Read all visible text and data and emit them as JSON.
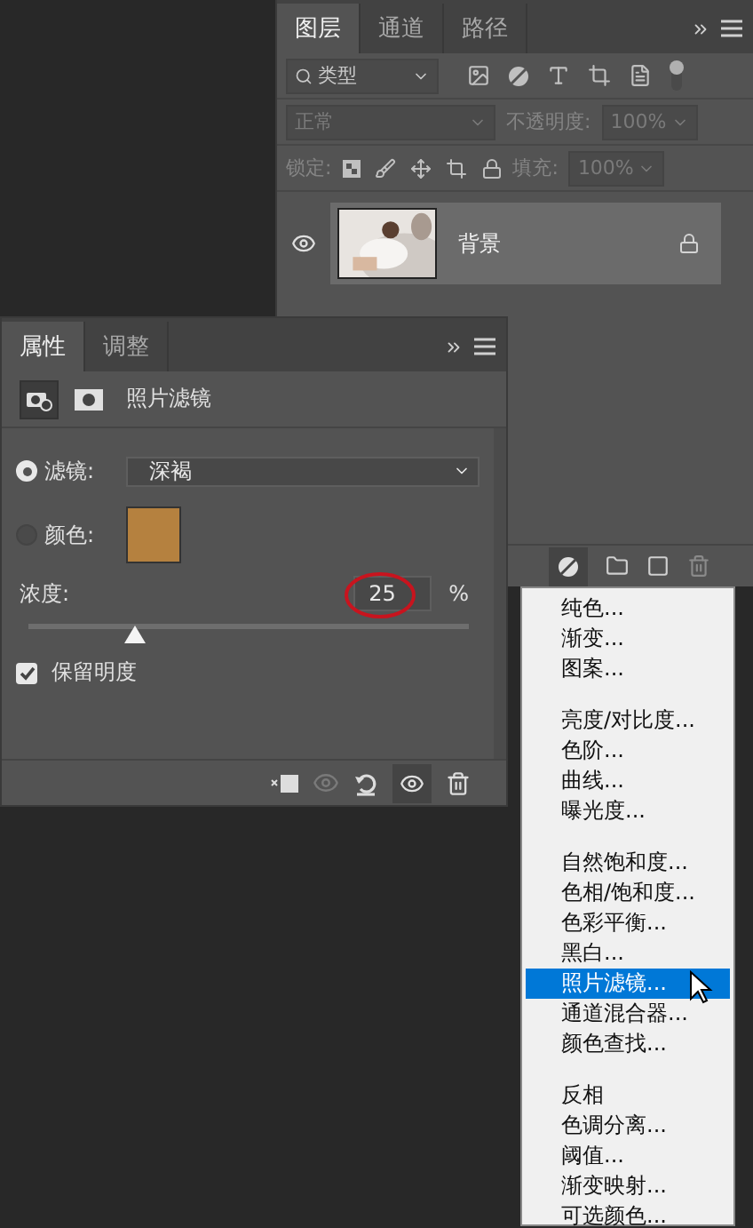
{
  "layers_panel": {
    "tabs": [
      {
        "label": "图层",
        "selected": true
      },
      {
        "label": "通道",
        "selected": false
      },
      {
        "label": "路径",
        "selected": false
      }
    ],
    "filter": {
      "label": "类型"
    },
    "blend_mode": "正常",
    "opacity_label": "不透明度:",
    "opacity": "100%",
    "lock_label": "锁定:",
    "fill_label": "填充:",
    "fill": "100%",
    "layers": [
      {
        "name": "背景",
        "visible": true,
        "locked": true,
        "selected": true
      }
    ]
  },
  "properties_panel": {
    "tabs": [
      {
        "label": "属性",
        "selected": true
      },
      {
        "label": "调整",
        "selected": false
      }
    ],
    "title": "照片滤镜",
    "options": [
      {
        "kind": "filter",
        "label": "滤镜:",
        "selected": true,
        "value": "深褐"
      },
      {
        "kind": "color",
        "label": "颜色:",
        "selected": false,
        "color": "#b5813f"
      }
    ],
    "density_label": "浓度:",
    "density": "25",
    "unit": "%",
    "density_slider": {
      "level": 0.24
    },
    "preserve": {
      "label": "保留明度",
      "checked": true
    }
  },
  "adjustment_menu": {
    "groups": [
      [
        {
          "label": "纯色...",
          "selected": false
        },
        {
          "label": "渐变...",
          "selected": false
        },
        {
          "label": "图案...",
          "selected": false
        }
      ],
      [
        {
          "label": "亮度/对比度...",
          "selected": false
        },
        {
          "label": "色阶...",
          "selected": false
        },
        {
          "label": "曲线...",
          "selected": false
        },
        {
          "label": "曝光度...",
          "selected": false
        }
      ],
      [
        {
          "label": "自然饱和度...",
          "selected": false
        },
        {
          "label": "色相/饱和度...",
          "selected": false
        },
        {
          "label": "色彩平衡...",
          "selected": false
        },
        {
          "label": "黑白...",
          "selected": false
        },
        {
          "label": "照片滤镜...",
          "selected": true
        },
        {
          "label": "通道混合器...",
          "selected": false
        },
        {
          "label": "颜色查找...",
          "selected": false
        }
      ],
      [
        {
          "label": "反相",
          "selected": false
        },
        {
          "label": "色调分离...",
          "selected": false
        },
        {
          "label": "阈值...",
          "selected": false
        },
        {
          "label": "渐变映射...",
          "selected": false
        },
        {
          "label": "可选颜色...",
          "selected": false
        }
      ]
    ]
  }
}
